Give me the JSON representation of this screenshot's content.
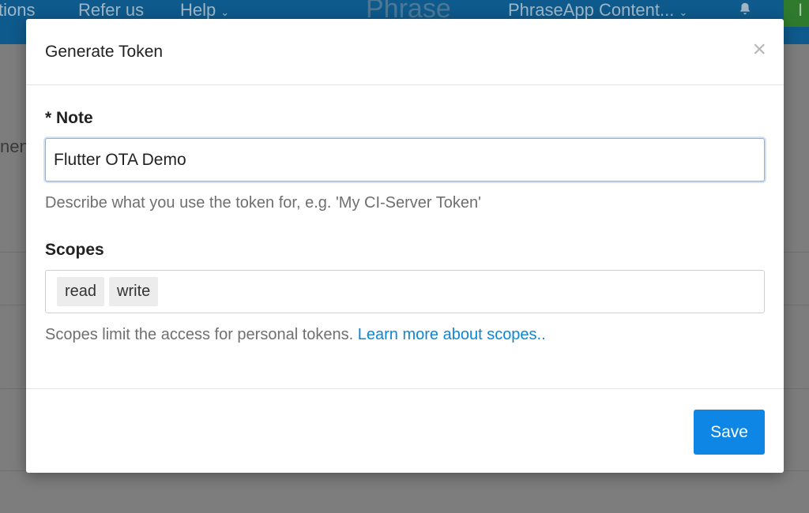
{
  "background": {
    "nav": {
      "left_partial": "tions",
      "refer": "Refer us",
      "help": "Help",
      "brand": "Phrase",
      "project": "PhraseApp Content...",
      "cta_partial": "I",
      "chevron_icon": "chevron-down-icon",
      "bell_icon": "bell-icon"
    },
    "side_text_partial": "nen"
  },
  "modal": {
    "title": "Generate Token",
    "close_icon": "×",
    "note": {
      "label": "* Note",
      "value": "Flutter OTA Demo",
      "help": "Describe what you use the token for, e.g. 'My CI-Server Token'"
    },
    "scopes": {
      "label": "Scopes",
      "tags": [
        "read",
        "write"
      ],
      "help_text": "Scopes limit the access for personal tokens.",
      "help_link": "Learn more about scopes.."
    },
    "save_label": "Save"
  },
  "colors": {
    "accent": "#0d86e6",
    "link": "#0d86d6",
    "topbar": "#0e5a8c"
  }
}
